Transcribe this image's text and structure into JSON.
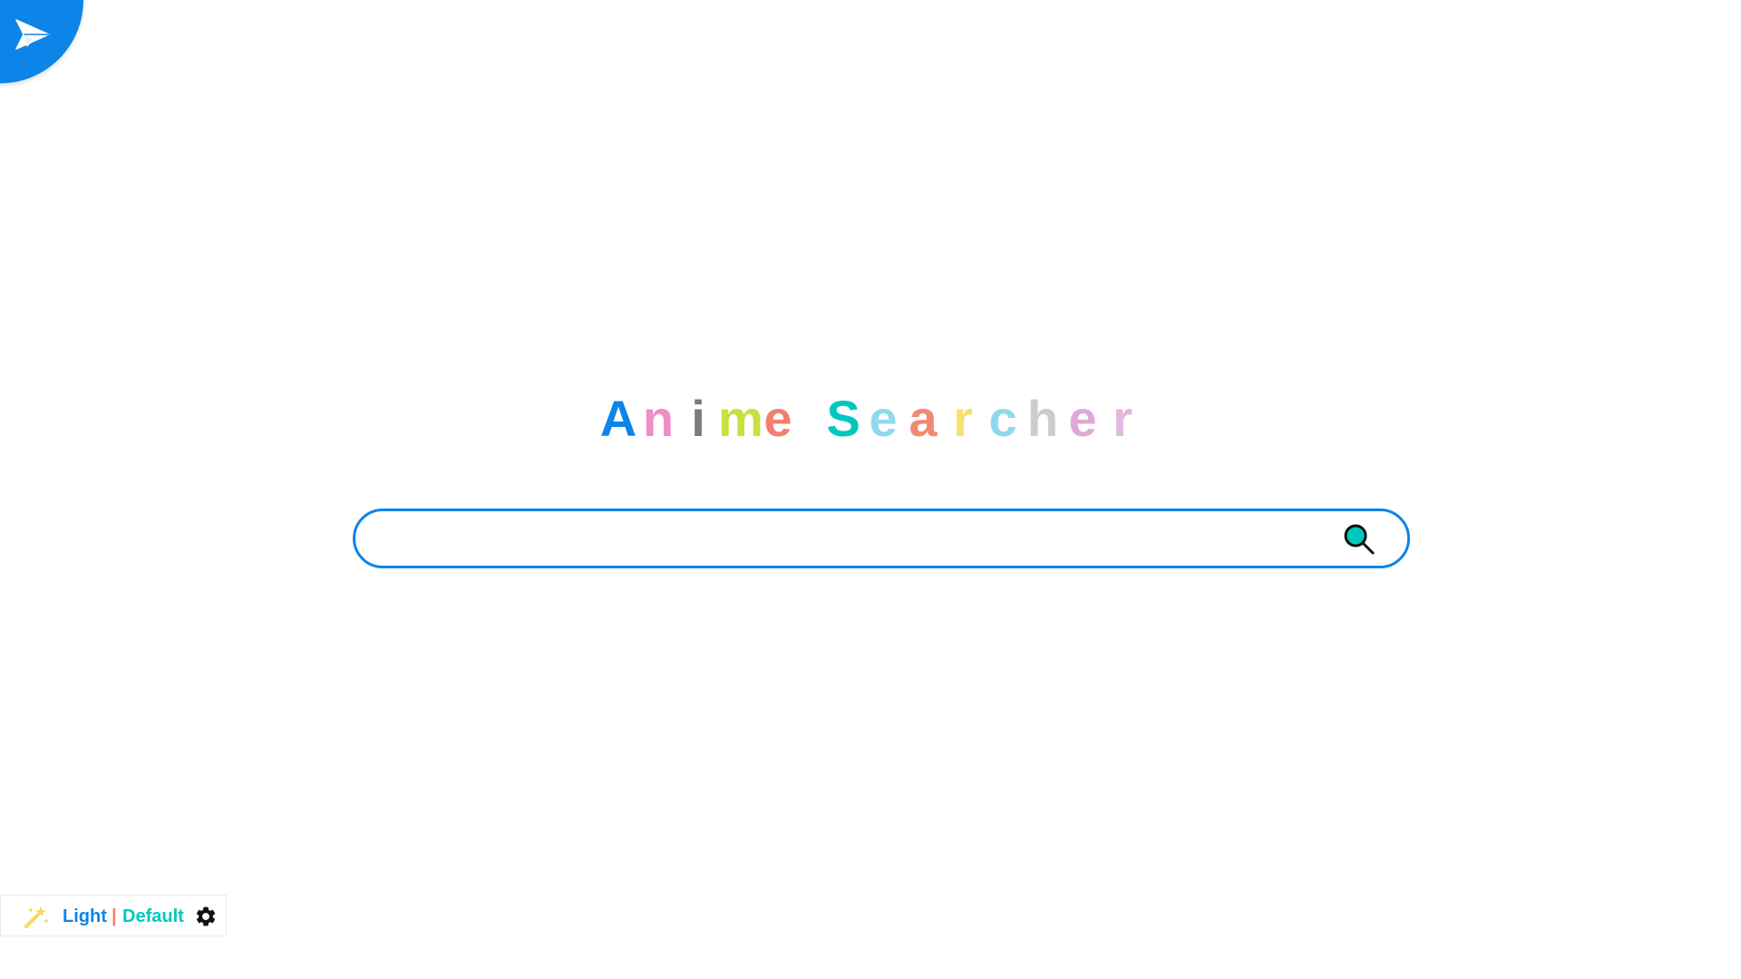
{
  "app": {
    "title_letters": [
      {
        "ch": "A",
        "color": "#0d84e8"
      },
      {
        "ch": "n",
        "color": "#f08cc8"
      },
      {
        "ch": "i",
        "color": "#7a7a7a"
      },
      {
        "ch": "m",
        "color": "#c8e040"
      },
      {
        "ch": "e",
        "color": "#f08070"
      },
      {
        "ch": " ",
        "color": "#ffffff"
      },
      {
        "ch": "S",
        "color": "#00c8bc"
      },
      {
        "ch": "e",
        "color": "#90d8f0"
      },
      {
        "ch": "a",
        "color": "#f08a70"
      },
      {
        "ch": "r",
        "color": "#f8e070"
      },
      {
        "ch": "c",
        "color": "#90d8f0"
      },
      {
        "ch": "h",
        "color": "#cccccc"
      },
      {
        "ch": "e",
        "color": "#e0a8d8"
      },
      {
        "ch": "r",
        "color": "#e0b8e0"
      }
    ]
  },
  "corner_badge": {
    "icon": "paper-plane-icon",
    "color": "#0d84e8"
  },
  "search": {
    "value": "",
    "placeholder": "",
    "button_icon": "search-icon",
    "border_color": "#0d84e8",
    "icon_fill": "#00c8bc"
  },
  "settings": {
    "wand_icon": "magic-wand-icon",
    "mode_label": "Light",
    "separator": "|",
    "theme_label": "Default",
    "gear_icon": "gear-icon"
  }
}
